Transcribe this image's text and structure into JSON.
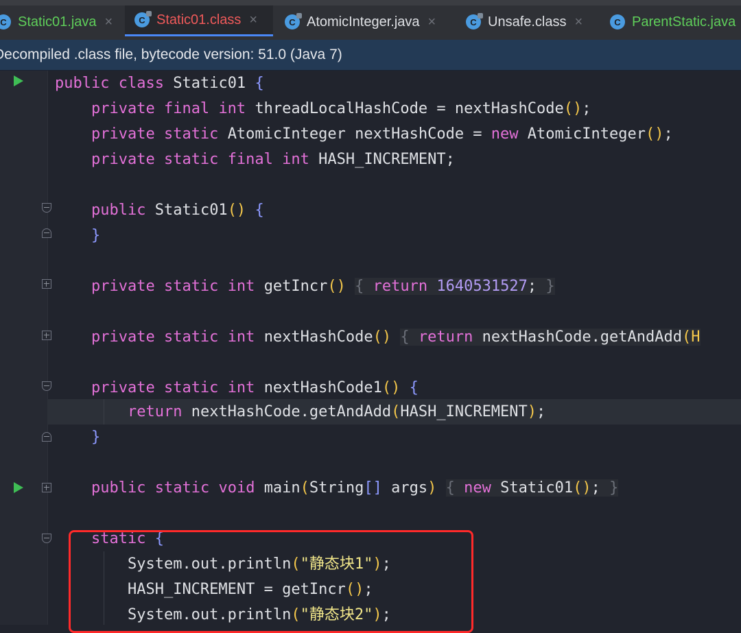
{
  "tabs": [
    {
      "label": "Static01.java",
      "color": "green",
      "icon": "java-class-icon",
      "active": false
    },
    {
      "label": "Static01.class",
      "color": "red",
      "icon": "compiled-class-icon",
      "active": true
    },
    {
      "label": "AtomicInteger.java",
      "color": "plain",
      "icon": "compiled-class-icon",
      "active": false
    },
    {
      "label": "Unsafe.class",
      "color": "plain",
      "icon": "compiled-class-icon",
      "active": false
    },
    {
      "label": "ParentStatic.java",
      "color": "green",
      "icon": "java-class-icon",
      "active": false
    }
  ],
  "tab_close": "×",
  "banner": "Decompiled .class file, bytecode version: 51.0 (Java 7)",
  "code": {
    "l1": [
      "public",
      "class",
      "Static01",
      "{"
    ],
    "l2": [
      "private",
      "final",
      "int",
      "threadLocalHashCode = nextHashCode",
      "()",
      ";"
    ],
    "l3": [
      "private",
      "static",
      "AtomicInteger nextHashCode = ",
      "new",
      "AtomicInteger",
      "()",
      ";"
    ],
    "l4": [
      "private",
      "static",
      "final",
      "int",
      "HASH_INCREMENT;"
    ],
    "l6": [
      "public",
      "Static01",
      "()",
      "{"
    ],
    "l7": [
      "}"
    ],
    "l9": [
      "private",
      "static",
      "int",
      "getIncr",
      "()",
      "{",
      "return",
      "1640531527",
      ";",
      "}"
    ],
    "l11": [
      "private",
      "static",
      "int",
      "nextHashCode",
      "()",
      "{",
      "return",
      "nextHashCode.getAndAdd",
      "(H"
    ],
    "l13": [
      "private",
      "static",
      "int",
      "nextHashCode1",
      "()",
      "{"
    ],
    "l14": [
      "return",
      "nextHashCode.getAndAdd",
      "(",
      "HASH_INCREMENT",
      ")",
      ";"
    ],
    "l15": [
      "}"
    ],
    "l17": [
      "public",
      "static",
      "void",
      "main",
      "(",
      "String",
      "[]",
      "args",
      ")",
      "{",
      "new",
      "Static01",
      "()",
      ";",
      "}"
    ],
    "l19": [
      "static",
      "{"
    ],
    "l20": [
      "System.out.println",
      "(",
      "\"静态块1\"",
      ")",
      ";"
    ],
    "l21": [
      "HASH_INCREMENT = getIncr",
      "()",
      ";"
    ],
    "l22": [
      "System.out.println",
      "(",
      "\"静态块2\"",
      ")",
      ";"
    ]
  },
  "colors": {
    "keyword": "#e371d8",
    "number": "#b39cf5",
    "string": "#f2e78a",
    "paren": "#f5c84b",
    "brace": "#8d99ff",
    "highlight_box": "#ff2a2a"
  }
}
